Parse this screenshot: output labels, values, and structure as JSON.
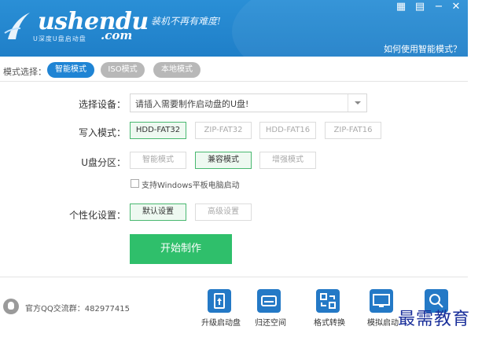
{
  "app": {
    "brand": "ushendu",
    "brand_suffix": ".com",
    "brand_sub": "U深度U盘启动盘",
    "slogan": "装机不再有难度!",
    "help_link": "如何使用智能模式？",
    "window_controls": [
      "grid-icon",
      "menu-icon",
      "minimize-icon",
      "close-icon"
    ]
  },
  "mode_bar": {
    "label": "模式选择：",
    "modes": [
      {
        "label": "智能模式",
        "active": true
      },
      {
        "label": "ISO模式",
        "active": false
      },
      {
        "label": "本地模式",
        "active": false
      }
    ]
  },
  "form": {
    "device": {
      "label": "选择设备：",
      "value": "请插入需要制作启动盘的U盘!"
    },
    "write_mode": {
      "label": "写入模式：",
      "options": [
        "HDD-FAT32",
        "ZIP-FAT32",
        "HDD-FAT16",
        "ZIP-FAT16"
      ],
      "selected": "HDD-FAT32"
    },
    "partition": {
      "label": "U盘分区：",
      "options": [
        "智能模式",
        "兼容模式",
        "增强模式"
      ],
      "selected": "兼容模式"
    },
    "tablet_checkbox": {
      "label": "支持Windows平板电脑启动",
      "checked": false
    },
    "personalize": {
      "label": "个性化设置：",
      "options": [
        "默认设置",
        "高级设置"
      ],
      "selected": "默认设置"
    },
    "start_button": "开始制作"
  },
  "footer": {
    "qq_group": "官方QQ交流群：482977415",
    "tools": [
      {
        "label": "升级启动盘",
        "icon": "upgrade-icon"
      },
      {
        "label": "归还空间",
        "icon": "disk-icon"
      },
      {
        "label": "格式转换",
        "icon": "convert-icon"
      },
      {
        "label": "模拟启动",
        "icon": "monitor-icon"
      },
      {
        "label": "",
        "icon": "search-icon"
      }
    ]
  },
  "watermark": "最需教育",
  "colors": {
    "header": "#1f7fc8",
    "accent": "#1f84d4",
    "start": "#2fbf6b",
    "tool": "#2479c6"
  }
}
